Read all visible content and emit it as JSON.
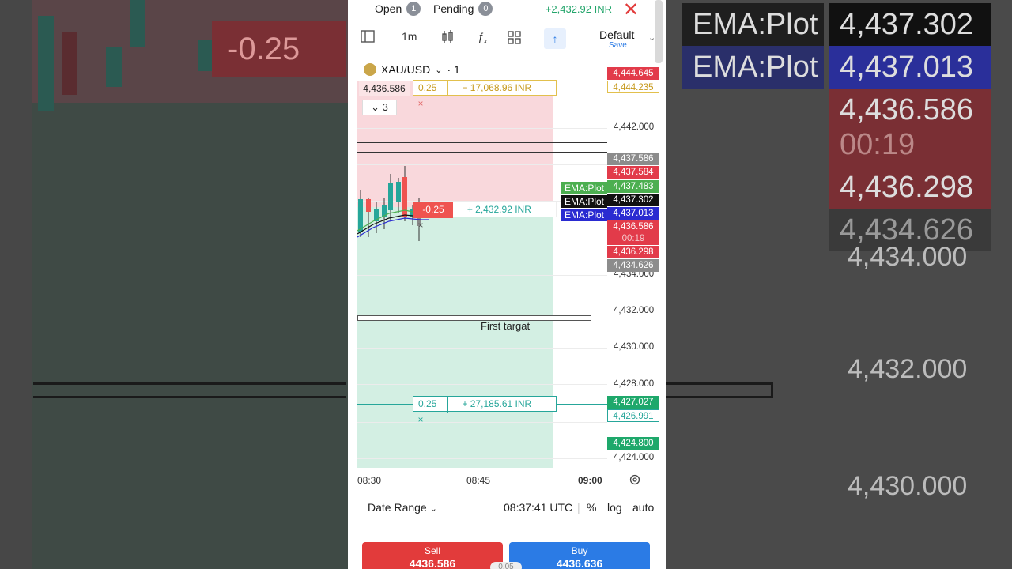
{
  "header": {
    "open_label": "Open",
    "open_count": "1",
    "pending_label": "Pending",
    "pending_count": "0",
    "pnl": "+2,432.92 INR"
  },
  "toolbar": {
    "timeframe": "1m",
    "layout_name": "Default",
    "save_label": "Save"
  },
  "chart": {
    "symbol": "XAU/USD",
    "interval": "· 1",
    "last_price_tag": "4,436.586",
    "indicator_count": "3",
    "target_label": "First targat",
    "orders": {
      "stop_qty": "0.25",
      "stop_amount": "− 17,068.96 INR",
      "position_qty": "-0.25",
      "position_amount": "+ 2,432.92 INR",
      "tp_qty": "0.25",
      "tp_amount": "+ 27,185.61 INR"
    },
    "price_axis": [
      "4,442.000",
      "4,434.000",
      "4,432.000",
      "4,430.000",
      "4,428.000",
      "4,424.000"
    ],
    "price_tags": {
      "high": "4,444.645",
      "stop": "4,444.235",
      "gray_top": "4,437.586",
      "red_a": "4,437.584",
      "ema1": "4,437.483",
      "ema2": "4,437.302",
      "ema3": "4,437.013",
      "current": "4,436.586",
      "countdown": "00:19",
      "red_b": "4,436.298",
      "gray_bottom": "4,434.626",
      "tp_green": "4,427.027",
      "tp_outline": "4,426.991",
      "low": "4,424.800"
    },
    "ema_labels": [
      "EMA:Plot",
      "EMA:Plot",
      "EMA:Plot"
    ],
    "time_axis": [
      "08:30",
      "08:45",
      "09:00"
    ],
    "colors": {
      "up": "#26a69a",
      "down": "#ef5350",
      "ema_green": "#4caf50",
      "ema_black": "#111111",
      "ema_blue": "#2a2bd1"
    }
  },
  "bottom": {
    "date_range": "Date Range",
    "clock": "08:37:41 UTC",
    "percent": "%",
    "log": "log",
    "auto": "auto"
  },
  "trade": {
    "sell_label": "Sell",
    "sell_price": "4436.586",
    "buy_label": "Buy",
    "buy_price": "4436.636",
    "spread": "0.05"
  },
  "background": {
    "badge": "-0.25",
    "ema_labels": [
      "EMA:Plot",
      "EMA:Plot"
    ],
    "prices": [
      "4,437.302",
      "4,437.013",
      "4,436.586",
      "00:19",
      "4,436.298",
      "4,434.626",
      "4,434.000",
      "4,432.000",
      "4,430.000"
    ]
  }
}
